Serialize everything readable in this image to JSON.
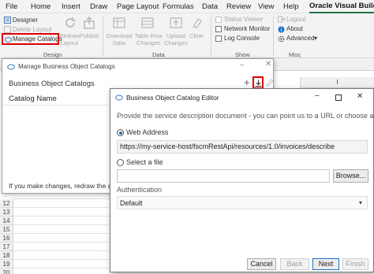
{
  "ribbon": {
    "tabs": [
      "File",
      "Home",
      "Insert",
      "Draw",
      "Page Layout",
      "Formulas",
      "Data",
      "Review",
      "View",
      "Help",
      "Oracle Visual Builder"
    ],
    "active_tab": "Oracle Visual Builder",
    "design": {
      "designer_label": "Designer",
      "delete_layout_label": "Delete Layout",
      "manage_catalogs_label": "Manage Catalogs",
      "redraw_label": "Redraw Layout",
      "publish_label": "Publish",
      "group_label": "Design"
    },
    "data": {
      "download_label": "Download Data",
      "table_row_label": "Table Row Changes",
      "upload_label": "Upload Changes",
      "clear_label": "Clear",
      "group_label": "Data"
    },
    "show": {
      "status_viewer_label": "Status Viewer",
      "network_monitor_label": "Network Monitor",
      "log_console_label": "Log Console",
      "group_label": "Show"
    },
    "misc": {
      "logout_label": "Logout",
      "about_label": "About",
      "advanced_label": "Advanced",
      "group_label": "Misc"
    }
  },
  "sheet": {
    "column_label": "I",
    "rows": [
      "12",
      "13",
      "14",
      "15",
      "16",
      "17",
      "18",
      "19",
      "20"
    ]
  },
  "catalogs_dialog": {
    "title": "Manage Business Object Catalogs",
    "heading": "Business Object Catalogs",
    "column_header": "Catalog Name",
    "message": "If you make changes, redraw the ass"
  },
  "editor_dialog": {
    "title": "Business Object Catalog Editor",
    "description": "Provide the service description document - you can point us to a URL or choose a file.",
    "web_address_label": "Web Address",
    "web_address_selected": true,
    "web_address_value": "https://my-service-host/fscmRestApi/resources/1.0/invoices/describe",
    "select_file_label": "Select a file",
    "file_path_value": "",
    "browse_label": "Browse...",
    "auth_label": "Authentication",
    "auth_value": "Default",
    "cancel_label": "Cancel",
    "back_label": "Back",
    "next_label": "Next",
    "finish_label": "Finish"
  },
  "colors": {
    "highlight": "#e00000",
    "excel_green": "#217346",
    "accent_blue": "#1a73c8"
  }
}
